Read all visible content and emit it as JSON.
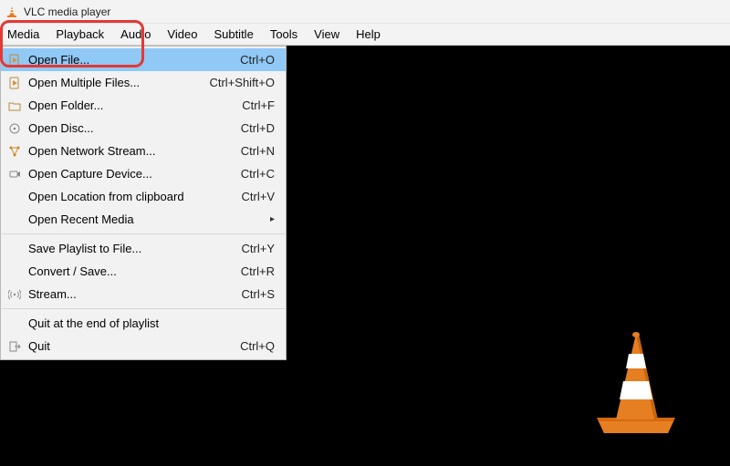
{
  "title": "VLC media player",
  "menubar": [
    "Media",
    "Playback",
    "Audio",
    "Video",
    "Subtitle",
    "Tools",
    "View",
    "Help"
  ],
  "dropdown": {
    "groups": [
      [
        {
          "icon": "file-play",
          "label": "Open File...",
          "shortcut": "Ctrl+O",
          "selected": true
        },
        {
          "icon": "file-play",
          "label": "Open Multiple Files...",
          "shortcut": "Ctrl+Shift+O"
        },
        {
          "icon": "folder",
          "label": "Open Folder...",
          "shortcut": "Ctrl+F"
        },
        {
          "icon": "disc",
          "label": "Open Disc...",
          "shortcut": "Ctrl+D"
        },
        {
          "icon": "network",
          "label": "Open Network Stream...",
          "shortcut": "Ctrl+N"
        },
        {
          "icon": "capture",
          "label": "Open Capture Device...",
          "shortcut": "Ctrl+C"
        },
        {
          "icon": "",
          "label": "Open Location from clipboard",
          "shortcut": "Ctrl+V"
        },
        {
          "icon": "",
          "label": "Open Recent Media",
          "shortcut": "",
          "submenu": true
        }
      ],
      [
        {
          "icon": "",
          "label": "Save Playlist to File...",
          "shortcut": "Ctrl+Y"
        },
        {
          "icon": "",
          "label": "Convert / Save...",
          "shortcut": "Ctrl+R"
        },
        {
          "icon": "stream",
          "label": "Stream...",
          "shortcut": "Ctrl+S"
        }
      ],
      [
        {
          "icon": "",
          "label": "Quit at the end of playlist",
          "shortcut": ""
        },
        {
          "icon": "quit",
          "label": "Quit",
          "shortcut": "Ctrl+Q"
        }
      ]
    ]
  }
}
